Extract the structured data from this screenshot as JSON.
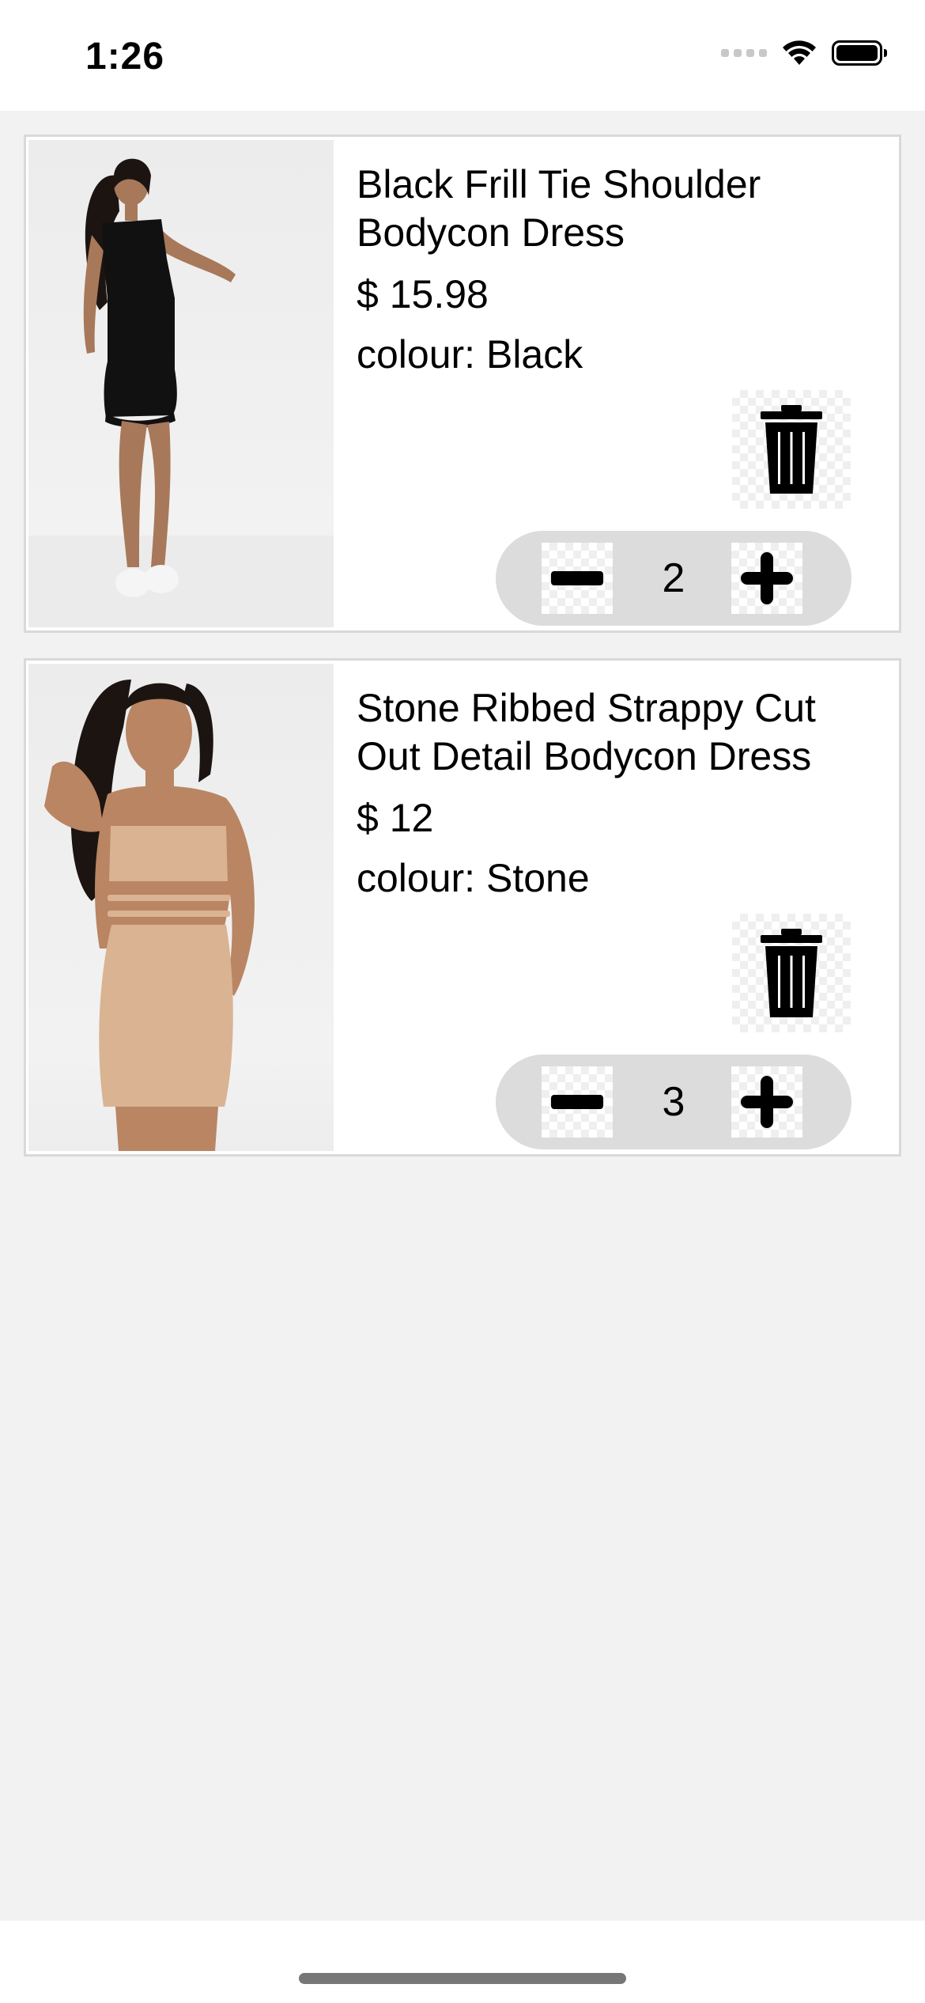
{
  "status_bar": {
    "time": "1:26"
  },
  "cart": {
    "items": [
      {
        "title": "Black Frill Tie Shoulder Bodycon Dress",
        "price": "$ 15.98",
        "colour": "colour: Black",
        "quantity": "2",
        "garment_color": "#111111"
      },
      {
        "title": "Stone Ribbed Strappy Cut Out Detail Bodycon Dress",
        "price": "$ 12",
        "colour": "colour: Stone",
        "quantity": "3",
        "garment_color": "#d9b392"
      }
    ]
  },
  "icons": {
    "delete": "trash-icon",
    "decrease": "minus-icon",
    "increase": "plus-icon",
    "wifi": "wifi-icon",
    "battery": "battery-icon"
  }
}
